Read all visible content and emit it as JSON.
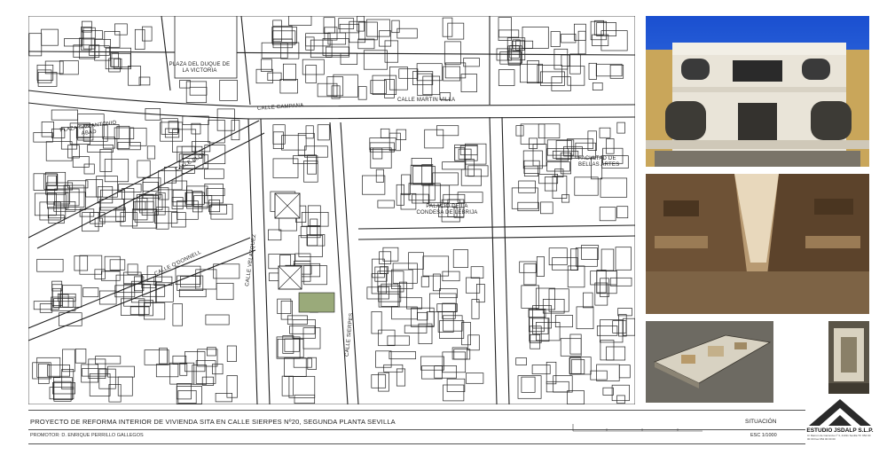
{
  "map": {
    "labels": {
      "plaza_duque": "PLAZA DEL DUQUE DE LA VICTORIA",
      "calle_campana": "CALLE CAMPANA",
      "calle_martin_villa": "CALLE MARTIN VILLA",
      "plaza_san_antonio": "PLAZA SAN ANTONIO ABAD",
      "calle_eloy": "CALLE ELOY",
      "facultad": "FACULTAD DE BELLAS ARTES",
      "palacio": "PALACIO DE LA CONDESA DE LEBRIJA",
      "calle_velazquez": "CALLE VELAZQUEZ",
      "calle_o_donnell": "CALLE O'DONNELL",
      "calle_sierpes": "CALLE SIERPES"
    }
  },
  "title_block": {
    "project_title": "PROYECTO DE REFORMA INTERIOR DE VIVIENDA SITA EN CALLE SIERPES Nº20, SEGUNDA PLANTA SEVILLA",
    "promotor": "PROMOTOR: D. Enrique Perrillo Gallegos",
    "sheet_name": "SITUACIÓN",
    "scale": "ESC 1/1000"
  },
  "logo": {
    "name": "ESTUDIO JSDALP S.L.P.",
    "address": "C/ Ramón de Carranza nº 3, 41011 Sevilla  Tlf. 954 00 00 00  Fax 954 00 00 00"
  },
  "colors": {
    "highlight_plot": "#9aaa7a",
    "sky": "#1f5ad6",
    "sepia": "#8c6b45"
  }
}
